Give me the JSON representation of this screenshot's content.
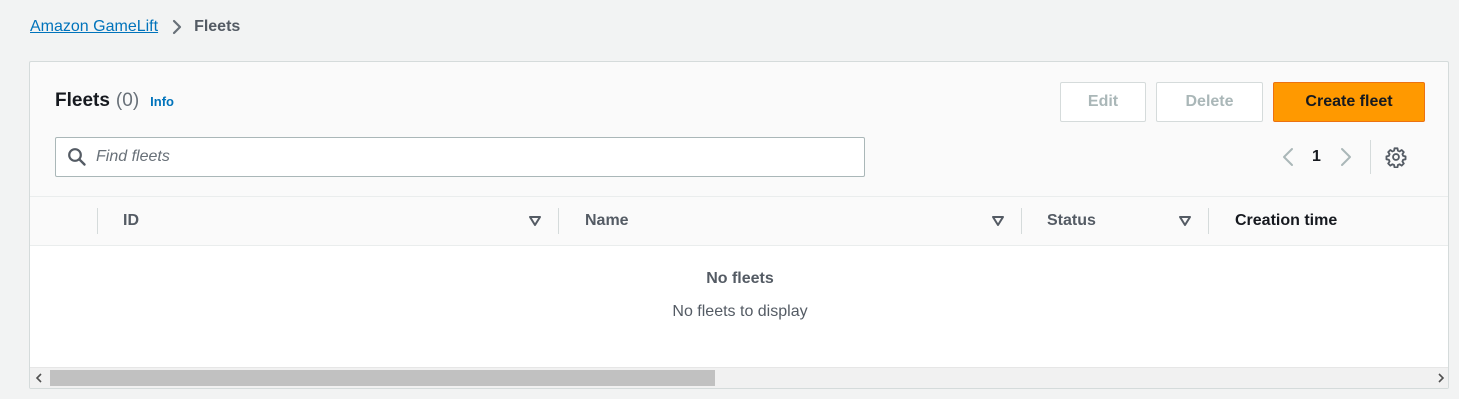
{
  "breadcrumb": {
    "parent": "Amazon GameLift",
    "current": "Fleets"
  },
  "panel": {
    "title": "Fleets",
    "count": "(0)",
    "info": "Info"
  },
  "actions": {
    "edit": "Edit",
    "delete": "Delete",
    "create": "Create fleet"
  },
  "search": {
    "placeholder": "Find fleets",
    "value": ""
  },
  "pagination": {
    "current_page": "1"
  },
  "table": {
    "columns": [
      {
        "label": "ID"
      },
      {
        "label": "Name"
      },
      {
        "label": "Status"
      },
      {
        "label": "Creation time"
      }
    ],
    "empty_title": "No fleets",
    "empty_text": "No fleets to display"
  },
  "colors": {
    "primary": "#ff9900",
    "link": "#0073bb",
    "background": "#f2f3f3"
  },
  "icons": [
    "chevron-right-icon",
    "search-icon",
    "chevron-left-icon",
    "gear-icon",
    "sort-caret-icon"
  ]
}
